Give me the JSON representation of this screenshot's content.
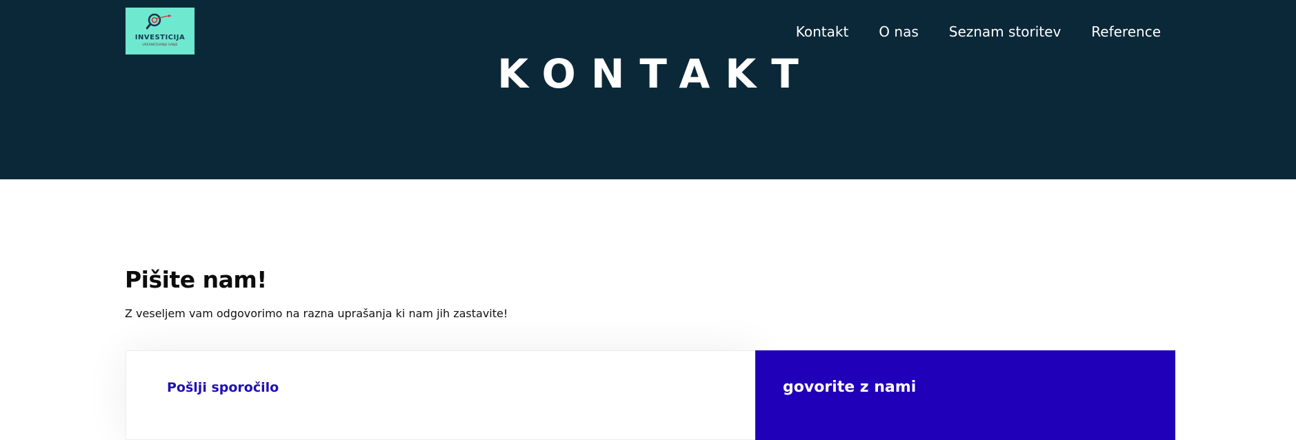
{
  "header": {
    "logo": {
      "name": "INVESTICIJA",
      "tagline": "URESNIČEVANJE SANJE",
      "icon": "magnifier-target-icon"
    },
    "nav": [
      "Kontakt",
      "O nas",
      "Seznam storitev",
      "Reference"
    ],
    "page_title": "KONTAKT"
  },
  "main": {
    "heading": "Pišite nam!",
    "intro": "Z veseljem vam odgovorimo na razna uprašanja ki nam jih zastavite!",
    "form_card": {
      "title": "Pošlji sporočilo"
    },
    "side_card": {
      "title": "govorite z nami"
    }
  },
  "colors": {
    "hero_bg": "#0b2838",
    "accent": "#2000b8",
    "logo_bg": "#6fe8d0"
  }
}
